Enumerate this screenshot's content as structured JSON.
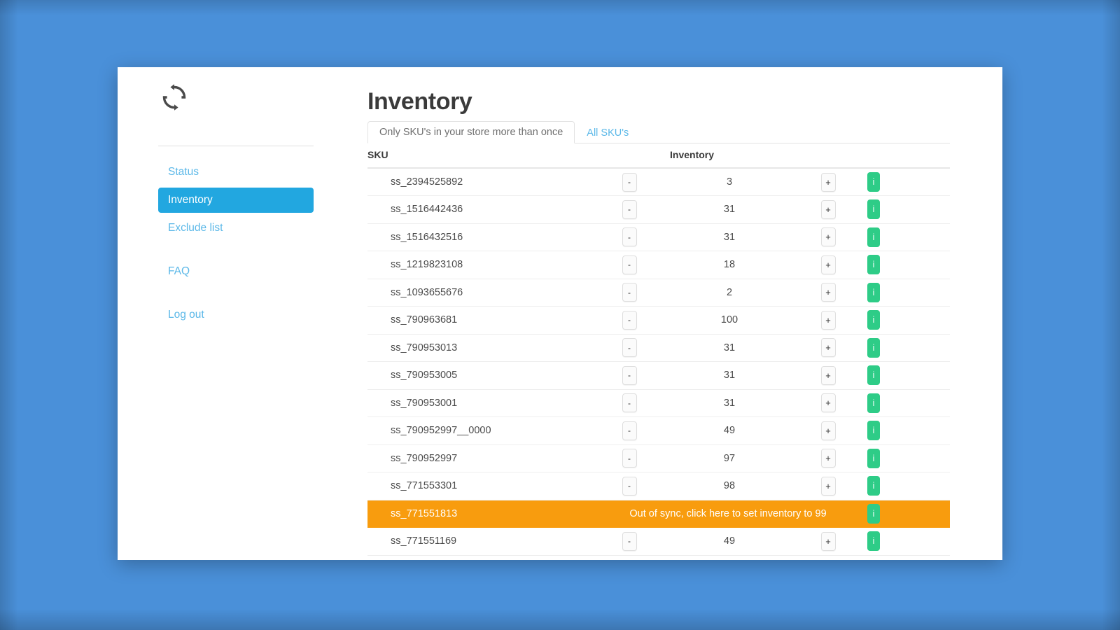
{
  "theme": {
    "page_background": "#4a90d9",
    "card_background": "#ffffff",
    "accent_blue": "#22a7e0",
    "link_blue": "#5bb8e8",
    "info_green": "#2ecc87",
    "warning_orange": "#f89c0e",
    "title_color": "#3a3a3a"
  },
  "sidebar": {
    "logo_icon": "sync-refresh-icon",
    "items": [
      {
        "label": "Status",
        "name": "sidebar-item-status",
        "active": false
      },
      {
        "label": "Inventory",
        "name": "sidebar-item-inventory",
        "active": true
      },
      {
        "label": "Exclude list",
        "name": "sidebar-item-exclude-list",
        "active": false
      },
      {
        "label": "FAQ",
        "name": "sidebar-item-faq",
        "active": false
      },
      {
        "label": "Log out",
        "name": "sidebar-item-log-out",
        "active": false
      }
    ]
  },
  "main": {
    "title": "Inventory",
    "tabs": [
      {
        "label": "Only SKU's in your store more than once",
        "active": true
      },
      {
        "label": "All SKU's",
        "active": false
      }
    ],
    "table": {
      "columns": {
        "sku": "SKU",
        "inventory": "Inventory"
      },
      "controls": {
        "decrement_label": "-",
        "increment_label": "+",
        "info_label": "i"
      },
      "rows": [
        {
          "sku": "ss_2394525892",
          "inventory": "3",
          "state": "normal"
        },
        {
          "sku": "ss_1516442436",
          "inventory": "31",
          "state": "normal"
        },
        {
          "sku": "ss_1516432516",
          "inventory": "31",
          "state": "normal"
        },
        {
          "sku": "ss_1219823108",
          "inventory": "18",
          "state": "normal"
        },
        {
          "sku": "ss_1093655676",
          "inventory": "2",
          "state": "normal"
        },
        {
          "sku": "ss_790963681",
          "inventory": "100",
          "state": "normal"
        },
        {
          "sku": "ss_790953013",
          "inventory": "31",
          "state": "normal"
        },
        {
          "sku": "ss_790953005",
          "inventory": "31",
          "state": "normal"
        },
        {
          "sku": "ss_790953001",
          "inventory": "31",
          "state": "normal"
        },
        {
          "sku": "ss_790952997__0000",
          "inventory": "49",
          "state": "normal"
        },
        {
          "sku": "ss_790952997",
          "inventory": "97",
          "state": "normal"
        },
        {
          "sku": "ss_771553301",
          "inventory": "98",
          "state": "normal"
        },
        {
          "sku": "ss_771551813",
          "inventory": "",
          "state": "out_of_sync",
          "message": "Out of sync, click here to set inventory to 99"
        },
        {
          "sku": "ss_771551169",
          "inventory": "49",
          "state": "normal"
        }
      ]
    }
  }
}
